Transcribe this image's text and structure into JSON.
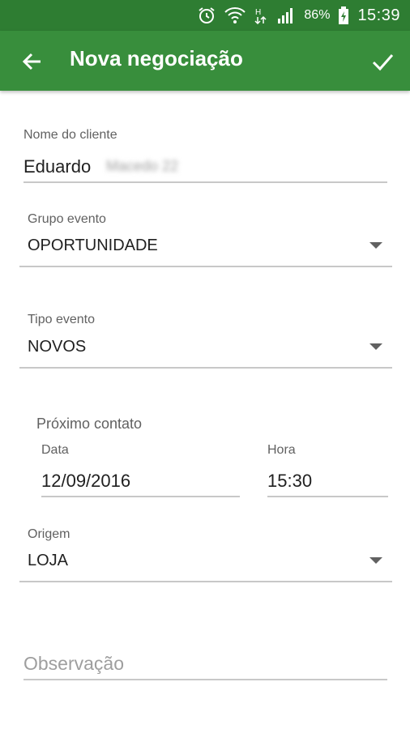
{
  "status_bar": {
    "icons": [
      "alarm-icon",
      "wifi-icon",
      "network-h-icon",
      "signal-icon",
      "battery-charging-icon"
    ],
    "battery": "86%",
    "time": "15:39"
  },
  "app_bar": {
    "title": "Nova negociação",
    "back_icon": "arrow-back-icon",
    "confirm_icon": "check-icon",
    "color": "#388e3c",
    "status_color": "#2e7d32"
  },
  "form": {
    "cliente": {
      "label": "Nome do cliente",
      "value": "Eduardo",
      "value_redacted": "Macedo 22"
    },
    "grupo_evento": {
      "label": "Grupo evento",
      "value": "OPORTUNIDADE"
    },
    "tipo_evento": {
      "label": "Tipo evento",
      "value": "NOVOS"
    },
    "proximo_contato": {
      "label": "Próximo contato",
      "data": {
        "label": "Data",
        "value": "12/09/2016"
      },
      "hora": {
        "label": "Hora",
        "value": "15:30"
      }
    },
    "origem": {
      "label": "Origem",
      "value": "LOJA"
    },
    "observacao": {
      "placeholder": "Observação"
    }
  }
}
